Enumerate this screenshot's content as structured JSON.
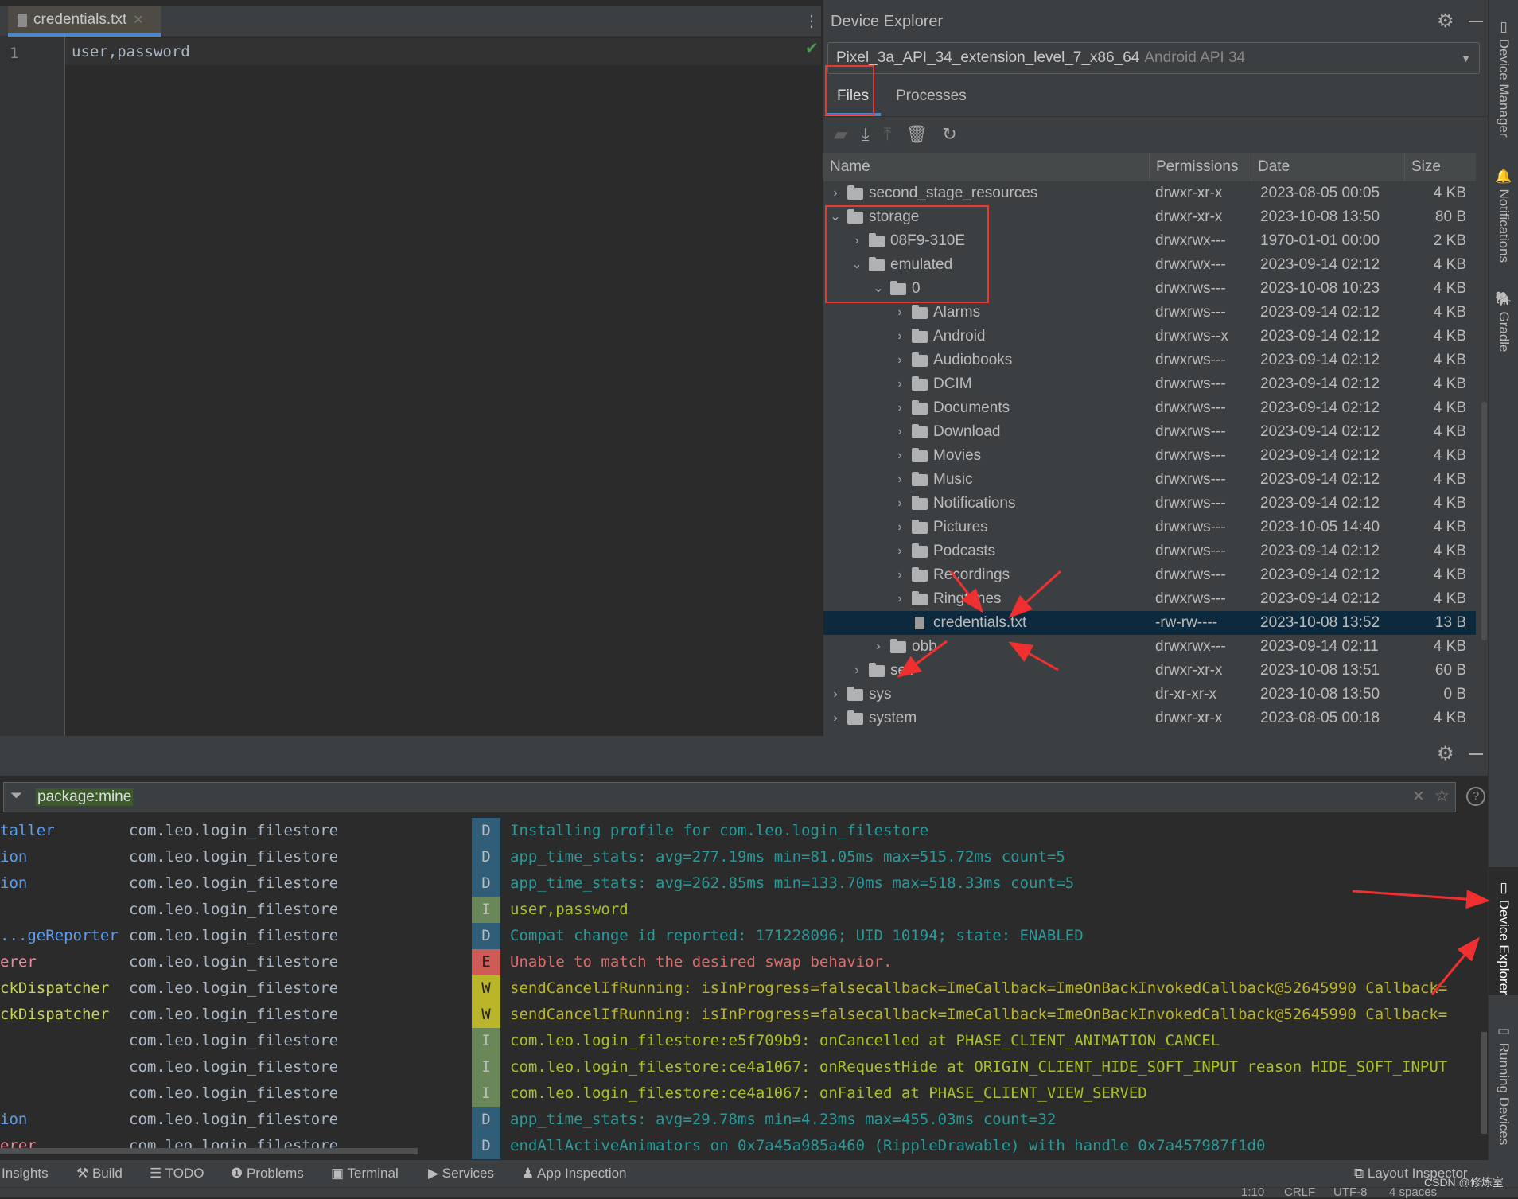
{
  "editor": {
    "tab_label": "credentials.txt",
    "line_number": "1",
    "content": "user,password"
  },
  "device_explorer": {
    "title": "Device Explorer",
    "device_name": "Pixel_3a_API_34_extension_level_7_x86_64",
    "device_api": "Android API 34",
    "tabs": [
      "Files",
      "Processes"
    ],
    "active_tab": "Files",
    "columns": [
      "Name",
      "Permissions",
      "Date",
      "Size"
    ],
    "rows": [
      {
        "name": "second_stage_resources",
        "level": 0,
        "expand": "collapsed",
        "type": "folder",
        "perm": "drwxr-xr-x",
        "date": "2023-08-05 00:05",
        "size": "4 KB"
      },
      {
        "name": "storage",
        "level": 0,
        "expand": "expanded",
        "type": "folder",
        "perm": "drwxr-xr-x",
        "date": "2023-10-08 13:50",
        "size": "80 B"
      },
      {
        "name": "08F9-310E",
        "level": 1,
        "expand": "collapsed",
        "type": "folder",
        "perm": "drwxrwx---",
        "date": "1970-01-01 00:00",
        "size": "2 KB"
      },
      {
        "name": "emulated",
        "level": 1,
        "expand": "expanded",
        "type": "folder",
        "perm": "drwxrwx---",
        "date": "2023-09-14 02:12",
        "size": "4 KB"
      },
      {
        "name": "0",
        "level": 2,
        "expand": "expanded",
        "type": "folder",
        "perm": "drwxrws---",
        "date": "2023-10-08 10:23",
        "size": "4 KB"
      },
      {
        "name": "Alarms",
        "level": 3,
        "expand": "collapsed",
        "type": "folder",
        "perm": "drwxrws---",
        "date": "2023-09-14 02:12",
        "size": "4 KB"
      },
      {
        "name": "Android",
        "level": 3,
        "expand": "collapsed",
        "type": "folder",
        "perm": "drwxrws--x",
        "date": "2023-09-14 02:12",
        "size": "4 KB"
      },
      {
        "name": "Audiobooks",
        "level": 3,
        "expand": "collapsed",
        "type": "folder",
        "perm": "drwxrws---",
        "date": "2023-09-14 02:12",
        "size": "4 KB"
      },
      {
        "name": "DCIM",
        "level": 3,
        "expand": "collapsed",
        "type": "folder",
        "perm": "drwxrws---",
        "date": "2023-09-14 02:12",
        "size": "4 KB"
      },
      {
        "name": "Documents",
        "level": 3,
        "expand": "collapsed",
        "type": "folder",
        "perm": "drwxrws---",
        "date": "2023-09-14 02:12",
        "size": "4 KB"
      },
      {
        "name": "Download",
        "level": 3,
        "expand": "collapsed",
        "type": "folder",
        "perm": "drwxrws---",
        "date": "2023-09-14 02:12",
        "size": "4 KB"
      },
      {
        "name": "Movies",
        "level": 3,
        "expand": "collapsed",
        "type": "folder",
        "perm": "drwxrws---",
        "date": "2023-09-14 02:12",
        "size": "4 KB"
      },
      {
        "name": "Music",
        "level": 3,
        "expand": "collapsed",
        "type": "folder",
        "perm": "drwxrws---",
        "date": "2023-09-14 02:12",
        "size": "4 KB"
      },
      {
        "name": "Notifications",
        "level": 3,
        "expand": "collapsed",
        "type": "folder",
        "perm": "drwxrws---",
        "date": "2023-09-14 02:12",
        "size": "4 KB"
      },
      {
        "name": "Pictures",
        "level": 3,
        "expand": "collapsed",
        "type": "folder",
        "perm": "drwxrws---",
        "date": "2023-10-05 14:40",
        "size": "4 KB"
      },
      {
        "name": "Podcasts",
        "level": 3,
        "expand": "collapsed",
        "type": "folder",
        "perm": "drwxrws---",
        "date": "2023-09-14 02:12",
        "size": "4 KB"
      },
      {
        "name": "Recordings",
        "level": 3,
        "expand": "collapsed",
        "type": "folder",
        "perm": "drwxrws---",
        "date": "2023-09-14 02:12",
        "size": "4 KB"
      },
      {
        "name": "Ringtones",
        "level": 3,
        "expand": "collapsed",
        "type": "folder",
        "perm": "drwxrws---",
        "date": "2023-09-14 02:12",
        "size": "4 KB"
      },
      {
        "name": "credentials.txt",
        "level": 3,
        "expand": "none",
        "type": "file",
        "perm": "-rw-rw----",
        "date": "2023-10-08 13:52",
        "size": "13 B",
        "selected": true
      },
      {
        "name": "obb",
        "level": 2,
        "expand": "collapsed",
        "type": "folder",
        "perm": "drwxrwx---",
        "date": "2023-09-14 02:11",
        "size": "4 KB"
      },
      {
        "name": "self",
        "level": 1,
        "expand": "collapsed",
        "type": "folder",
        "perm": "drwxr-xr-x",
        "date": "2023-10-08 13:51",
        "size": "60 B"
      },
      {
        "name": "sys",
        "level": 0,
        "expand": "collapsed",
        "type": "folder",
        "perm": "dr-xr-xr-x",
        "date": "2023-10-08 13:50",
        "size": "0 B"
      },
      {
        "name": "system",
        "level": 0,
        "expand": "collapsed",
        "type": "folder",
        "perm": "drwxr-xr-x",
        "date": "2023-08-05 00:18",
        "size": "4 KB"
      }
    ]
  },
  "logcat": {
    "filter": "package:mine",
    "rows": [
      {
        "tag": "taller",
        "tagColor": "#5c9ded",
        "pkg": "com.leo.login_filestore",
        "level": "D",
        "msg": "Installing profile for com.leo.login_filestore"
      },
      {
        "tag": "ion",
        "tagColor": "#5c9ded",
        "pkg": "com.leo.login_filestore",
        "level": "D",
        "msg": "app_time_stats: avg=277.19ms min=81.05ms max=515.72ms count=5"
      },
      {
        "tag": "ion",
        "tagColor": "#5c9ded",
        "pkg": "com.leo.login_filestore",
        "level": "D",
        "msg": "app_time_stats: avg=262.85ms min=133.70ms max=518.33ms count=5"
      },
      {
        "tag": "",
        "tagColor": "#5c9ded",
        "pkg": "com.leo.login_filestore",
        "level": "I",
        "msg": "user,password"
      },
      {
        "tag": "...geReporter",
        "tagColor": "#5c9ded",
        "pkg": "com.leo.login_filestore",
        "level": "D",
        "msg": "Compat change id reported: 171228096; UID 10194; state: ENABLED"
      },
      {
        "tag": "erer",
        "tagColor": "#e88a9a",
        "pkg": "com.leo.login_filestore",
        "level": "E",
        "msg": "Unable to match the desired swap behavior."
      },
      {
        "tag": "ckDispatcher",
        "tagColor": "#c8d35a",
        "pkg": "com.leo.login_filestore",
        "level": "W",
        "msg": "sendCancelIfRunning: isInProgress=falsecallback=ImeCallback=ImeOnBackInvokedCallback@52645990 Callback="
      },
      {
        "tag": "ckDispatcher",
        "tagColor": "#c8d35a",
        "pkg": "com.leo.login_filestore",
        "level": "W",
        "msg": "sendCancelIfRunning: isInProgress=falsecallback=ImeCallback=ImeOnBackInvokedCallback@52645990 Callback="
      },
      {
        "tag": "",
        "tagColor": "#5c9ded",
        "pkg": "com.leo.login_filestore",
        "level": "I",
        "msg": "com.leo.login_filestore:e5f709b9: onCancelled at PHASE_CLIENT_ANIMATION_CANCEL"
      },
      {
        "tag": "",
        "tagColor": "#5c9ded",
        "pkg": "com.leo.login_filestore",
        "level": "I",
        "msg": "com.leo.login_filestore:ce4a1067: onRequestHide at ORIGIN_CLIENT_HIDE_SOFT_INPUT reason HIDE_SOFT_INPUT"
      },
      {
        "tag": "",
        "tagColor": "#5c9ded",
        "pkg": "com.leo.login_filestore",
        "level": "I",
        "msg": "com.leo.login_filestore:ce4a1067: onFailed at PHASE_CLIENT_VIEW_SERVED"
      },
      {
        "tag": "ion",
        "tagColor": "#5c9ded",
        "pkg": "com.leo.login_filestore",
        "level": "D",
        "msg": "app_time_stats: avg=29.78ms min=4.23ms max=455.03ms count=32"
      },
      {
        "tag": "erer",
        "tagColor": "#e88a9a",
        "pkg": "com.leo.login_filestore",
        "level": "D",
        "msg": "endAllActiveAnimators on 0x7a45a985a460 (RippleDrawable) with handle 0x7a457987f1d0"
      }
    ],
    "level_colors": {
      "D": {
        "bg": "#305d78",
        "fg": "#299999"
      },
      "I": {
        "bg": "#6a8759",
        "fg": "#abc023"
      },
      "W": {
        "bg": "#bbb529",
        "fg": "#bbb529"
      },
      "E": {
        "bg": "#cf5b56",
        "fg": "#e06c6c"
      }
    }
  },
  "bottom_toolbar": {
    "items": [
      "Insights",
      "Build",
      "TODO",
      "Problems",
      "Terminal",
      "Services",
      "App Inspection"
    ],
    "layout_inspector": "Layout Inspector"
  },
  "status_bar": {
    "position": "1:10",
    "line_sep": "CRLF",
    "encoding": "UTF-8",
    "indent": "4 spaces"
  },
  "right_stripe": [
    "Device Manager",
    "Notifications",
    "Gradle",
    "Device Explorer",
    "Running Devices"
  ],
  "watermark": "CSDN @修炼室"
}
